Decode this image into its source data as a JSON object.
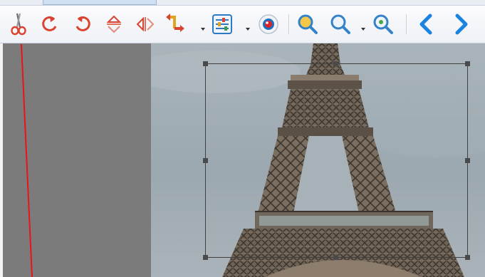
{
  "toolbar": {
    "buttons": [
      {
        "id": "cut",
        "icon": "scissors-icon"
      },
      {
        "id": "rotate-left",
        "icon": "rotate-left-icon"
      },
      {
        "id": "rotate-right",
        "icon": "rotate-right-icon"
      },
      {
        "id": "flip-vertical",
        "icon": "flip-vertical-icon"
      },
      {
        "id": "flip-horizontal",
        "icon": "flip-horizontal-icon"
      },
      {
        "id": "transform",
        "icon": "transform-arrows-icon",
        "has_dropdown": true
      },
      {
        "id": "adjust",
        "icon": "adjustments-icon",
        "has_dropdown": true
      },
      {
        "id": "red-eye",
        "icon": "red-eye-icon"
      },
      {
        "id": "zoom-in",
        "icon": "zoom-in-icon"
      },
      {
        "id": "zoom-out",
        "icon": "zoom-out-icon",
        "has_dropdown": true
      },
      {
        "id": "zoom-fit",
        "icon": "zoom-fit-icon"
      },
      {
        "id": "previous",
        "icon": "chevron-left-icon"
      },
      {
        "id": "next",
        "icon": "chevron-right-icon"
      }
    ]
  },
  "colors": {
    "toolbar_bg": "#f3f5f9",
    "canvas_bg": "#7b7b7b",
    "red_icon": "#d9432f",
    "blue_icon": "#1a82e0",
    "crop_border": "#404040",
    "pointer_line": "#e8141b"
  },
  "canvas": {
    "image_subject": "eiffel-tower-photo",
    "crop_selection_visible": true
  }
}
